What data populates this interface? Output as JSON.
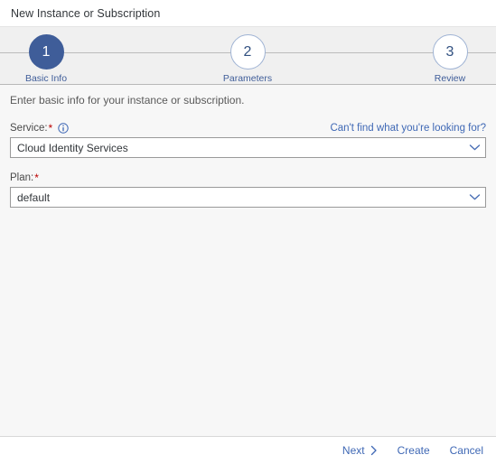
{
  "dialog": {
    "title": "New Instance or Subscription"
  },
  "wizard": {
    "steps": [
      {
        "number": "1",
        "label": "Basic Info",
        "state": "active"
      },
      {
        "number": "2",
        "label": "Parameters",
        "state": "inactive"
      },
      {
        "number": "3",
        "label": "Review",
        "state": "inactive"
      }
    ]
  },
  "content": {
    "intro": "Enter basic info for your instance or subscription.",
    "service_field": {
      "label": "Service:",
      "required_marker": "*",
      "info_icon": "info-circle-icon",
      "help_link": "Can't find what you're looking for?",
      "value": "Cloud Identity Services",
      "chevron_icon": "chevron-down-icon"
    },
    "plan_field": {
      "label": "Plan:",
      "required_marker": "*",
      "value": "default",
      "chevron_icon": "chevron-down-icon"
    }
  },
  "footer": {
    "next_label": "Next",
    "next_icon": "chevron-right-icon",
    "create_label": "Create",
    "cancel_label": "Cancel"
  },
  "colors": {
    "accent_blue": "#3f5d99",
    "link_blue": "#3f68b5",
    "required_red": "#bb0000",
    "band_gray": "#f0f0f0",
    "content_gray": "#f7f7f7"
  }
}
